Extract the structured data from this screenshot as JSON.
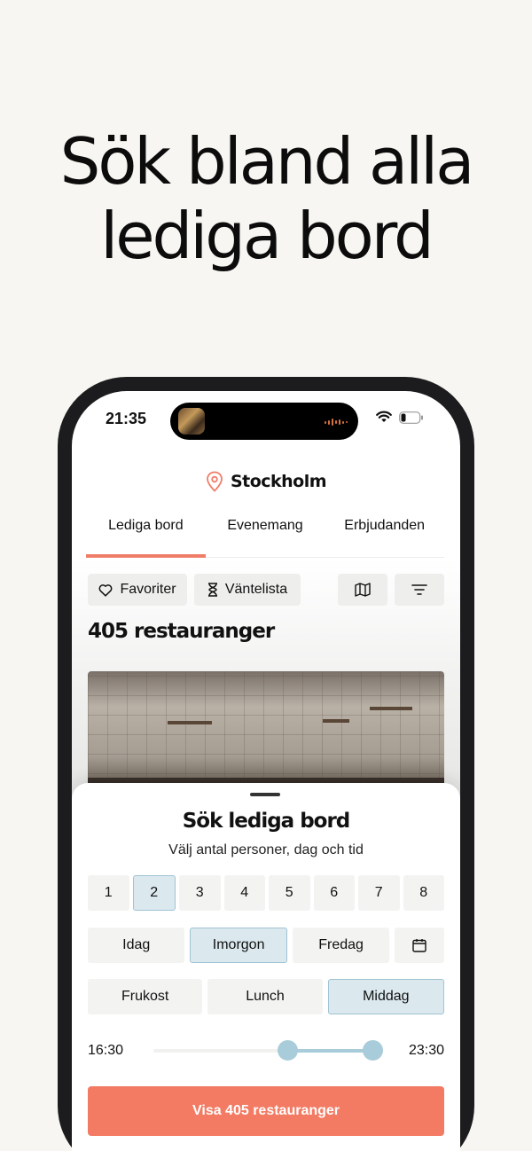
{
  "headline": {
    "line1": "Sök bland alla",
    "line2": "lediga bord"
  },
  "status_bar": {
    "time": "21:35"
  },
  "header": {
    "location": "Stockholm"
  },
  "tabs": [
    {
      "label": "Lediga bord",
      "active": true
    },
    {
      "label": "Evenemang",
      "active": false
    },
    {
      "label": "Erbjudanden",
      "active": false
    }
  ],
  "filters": {
    "favorites_label": "Favoriter",
    "waitlist_label": "Väntelista"
  },
  "results": {
    "count_title": "405 restauranger"
  },
  "sheet": {
    "title": "Sök lediga bord",
    "subtitle": "Välj antal personer, dag och tid",
    "party_sizes": [
      "1",
      "2",
      "3",
      "4",
      "5",
      "6",
      "7",
      "8"
    ],
    "selected_party_size": "2",
    "days": [
      "Idag",
      "Imorgon",
      "Fredag"
    ],
    "selected_day": "Imorgon",
    "meals": [
      "Frukost",
      "Lunch",
      "Middag"
    ],
    "selected_meal": "Middag",
    "time_start": "16:30",
    "time_end": "23:30",
    "cta_label": "Visa 405 restauranger"
  },
  "colors": {
    "accent": "#f37a63",
    "selected_bg": "#dbe9ef",
    "slider": "#a8ccd9"
  }
}
